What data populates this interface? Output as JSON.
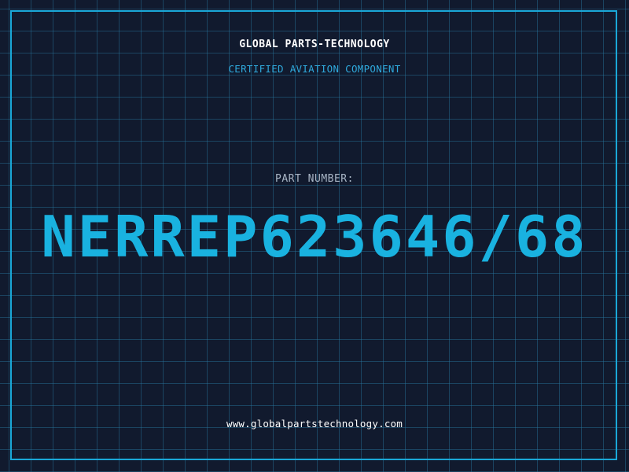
{
  "header": {
    "company": "GLOBAL PARTS-TECHNOLOGY",
    "subtitle": "CERTIFIED AVIATION COMPONENT"
  },
  "main": {
    "label": "PART NUMBER:",
    "part_number": "NERREP623646/68"
  },
  "footer": {
    "website": "www.globalpartstechnology.com"
  },
  "colors": {
    "background": "#111a2e",
    "grid": "#28789f",
    "accent": "#19b2e0",
    "frame": "#1aa8d8",
    "label": "#a9b6c6",
    "text": "#ffffff"
  }
}
